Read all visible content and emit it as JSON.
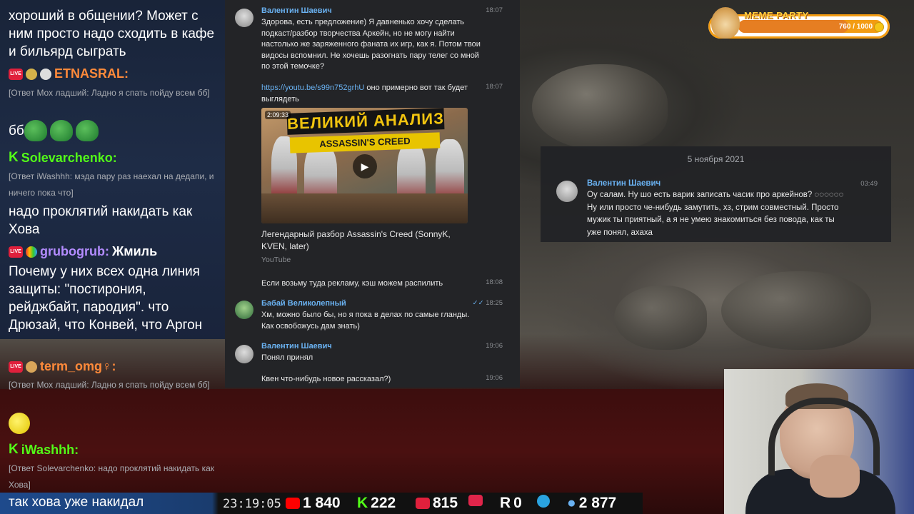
{
  "chat": {
    "top_fragment": "хороший в общении? Может с ним просто надо сходить в кафе и бильярд сыграть",
    "messages": [
      {
        "user": "ETNASRAL:",
        "reply": "[Ответ Mox ладший: Ладно я спать пойду всем бб]",
        "text": "бб"
      },
      {
        "user": "Solevarchenko:",
        "reply": "[Ответ iWashhh: мэда пару раз наехал на дедапи, и ничего пока что]",
        "text": "надо проклятий накидать как Хова"
      },
      {
        "user": "grubogrub:",
        "user_suffix": "Жмиль",
        "text": "Почему у них всех одна линия защиты: \"постирония, рейджбайт, пародия\". что Дрюзай, что Конвей, что Аргон"
      },
      {
        "user": "term_omg♀:",
        "reply": "[Ответ Mox ладший: Ладно я спать пойду всем бб]"
      },
      {
        "user": "iWashhh:",
        "reply": "[Ответ Solevarchenko: надо проклятий накидать как Хова]",
        "text": "так хова уже накидал"
      }
    ]
  },
  "stats": {
    "clock": "23:19:05",
    "youtube": "1 840",
    "kick": "222",
    "live": "815",
    "rumble": "0",
    "viewers": "2 877"
  },
  "telegram": {
    "messages": [
      {
        "author": "Валентин Шаевич",
        "time": "18:07",
        "text": "Здорова, есть предложение) Я давненько хочу сделать подкаст/разбор творчества Аркейн, но не могу найти настолько же заряженного фаната их игр, как я. Потом твои видосы вспомнил. Не хочешь разогнать пару телег со мной по этой темочке?"
      },
      {
        "time": "18:07",
        "link": "https://youtu.be/s99n752grhU",
        "text": " оно примерно вот так будет выглядеть"
      },
      {
        "video_title": "Легендарный разбор Assassin's Creed (SonnyK, KVEN, later)",
        "video_source": "YouTube",
        "duration": "2:09:33",
        "thumb_title": "ВЕЛИКИЙ АНАЛИЗ",
        "thumb_sub": "ASSASSIN'S CREED"
      },
      {
        "time": "18:08",
        "text": "Если возьму туда рекламу, кэш можем распилить"
      },
      {
        "author": "Бабай Великолепный",
        "time": "18:25",
        "text": "Хм, можно было бы, но я пока в делах по самые гланды. Как освобожусь дам знать)"
      },
      {
        "author": "Валентин Шаевич",
        "time": "19:06",
        "text": "Понял принял"
      },
      {
        "time": "19:06",
        "text": "Квен что-нибудь новое рассказал?)"
      }
    ]
  },
  "card": {
    "date": "5 ноября 2021",
    "author": "Валентин Шаевич",
    "time": "03:49",
    "text": "Оу салам. Ну шо есть варик записать часик про аркейнов? ◌◌◌◌◌◌ Ну или просто че-нибудь замутить, хз, стрим совместный. Просто мужик ты приятный, а я не умею знакомиться без повода, как ты уже понял, ахаха"
  },
  "meme_party": {
    "label": "MEME PARTY",
    "count": "760 / 1000",
    "progress": 0.76
  },
  "colors": {
    "accent_link": "#6ab2f2",
    "kick_green": "#53fc18",
    "live_red": "#e0203c",
    "meme_orange": "#f39c12"
  }
}
